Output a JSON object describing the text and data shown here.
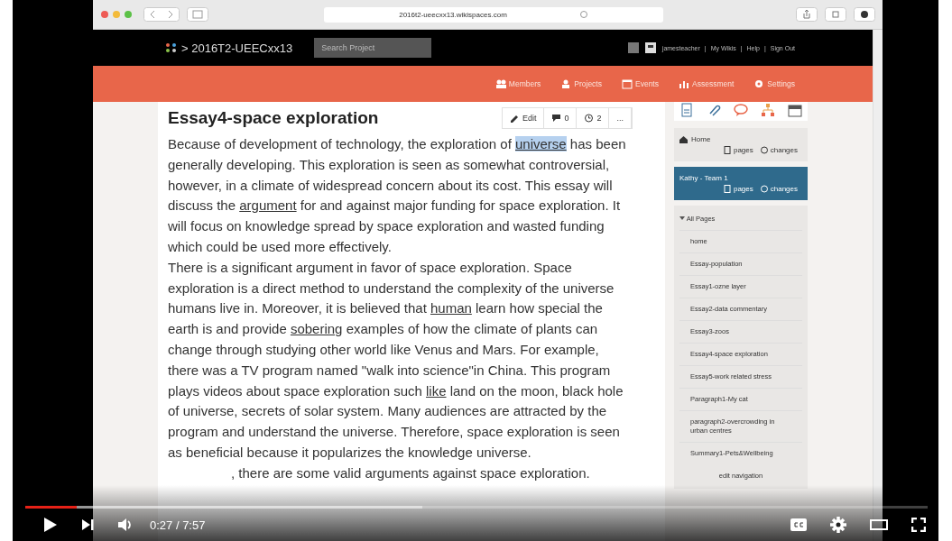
{
  "browser": {
    "url": "2016t2-ueecxx13.wikispaces.com"
  },
  "site": {
    "title": "> 2016T2-UEECxx13",
    "search": {
      "placeholder": "Search Project"
    },
    "user_links": [
      "jamesteacher",
      "My Wikis",
      "Help",
      "Sign Out"
    ],
    "link_separator": "|"
  },
  "menu": [
    {
      "label": "Members"
    },
    {
      "label": "Projects"
    },
    {
      "label": "Events"
    },
    {
      "label": "Assessment"
    },
    {
      "label": "Settings"
    }
  ],
  "page": {
    "title": "Essay4-space exploration",
    "actions": [
      {
        "kind": "edit",
        "label": "Edit"
      },
      {
        "kind": "comments",
        "label": "0"
      },
      {
        "kind": "history",
        "label": "2"
      },
      {
        "kind": "more",
        "label": "..."
      }
    ],
    "paragraphs": [
      [
        {
          "text": "Because of development of technology, the exploration of ",
          "underlined": false,
          "selected": false
        },
        {
          "text": "universe",
          "underlined": true,
          "selected": true
        },
        {
          "text": " has been generally developing. This exploration is seen as somewhat controversial, however, in a climate of widespread concern about its cost. This essay will discuss the ",
          "underlined": false,
          "selected": false
        },
        {
          "text": "argument",
          "underlined": true,
          "selected": false
        },
        {
          "text": " for and against major funding for space exploration. It will focus on knowledge spread by space exploration and wasted funding which could be used more effectively.",
          "underlined": false,
          "selected": false
        }
      ],
      [
        {
          "text": "There is a significant argument in favor of space exploration. Space exploration is a direct method to understand the complexity of the universe humans live in. Moreover, it is believed that ",
          "underlined": false,
          "selected": false
        },
        {
          "text": "human",
          "underlined": true,
          "selected": false
        },
        {
          "text": " learn how special the earth is and provide ",
          "underlined": false,
          "selected": false
        },
        {
          "text": "sobering",
          "underlined": true,
          "selected": false
        },
        {
          "text": " examples of how the climate of plants can change through studying other world like Venus and Mars. For example, there was a TV program named \"walk into science\"in China. This program plays videos about space exploration such ",
          "underlined": false,
          "selected": false
        },
        {
          "text": "like",
          "underlined": true,
          "selected": false
        },
        {
          "text": " land on the moon, black hole of universe, secrets of solar system. Many audiences are attracted by the program and understand the universe. Therefore, space exploration is seen as beneficial because it popularizes the knowledge universe.",
          "underlined": false,
          "selected": false
        }
      ],
      [
        {
          "text": ", there are some valid arguments against space exploration.",
          "underlined": false,
          "selected": false
        }
      ]
    ]
  },
  "sidebar": {
    "teams": [
      {
        "name": "Home",
        "links": [
          "pages",
          "changes"
        ],
        "selected": false
      },
      {
        "name": "Kathy - Team 1",
        "links": [
          "pages",
          "changes"
        ],
        "selected": true
      }
    ],
    "all_pages": {
      "label": "All Pages",
      "expanded": true,
      "items": [
        "home",
        "Essay-population",
        "Essay1-ozne layer",
        "Essay2-data commentary",
        "Essay3-zoos",
        "Essay4-space exploration",
        "Essay5-work related stress",
        "Paragraph1-My cat",
        "paragraph2-overcrowding in urban centres",
        "Summary1-Pets&Wellbeing"
      ]
    },
    "edit_link": "edit navigation"
  },
  "player": {
    "playing": false,
    "level": 0.057,
    "time": "0:27 / 7:57"
  }
}
